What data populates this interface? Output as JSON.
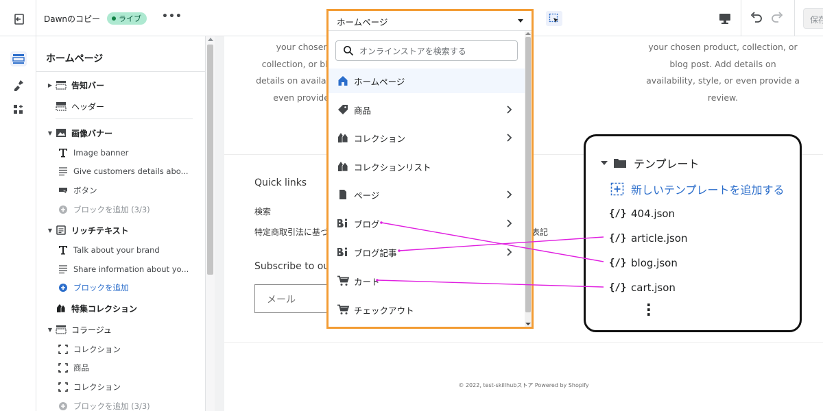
{
  "topbar": {
    "theme_name": "Dawnのコピー",
    "live_badge": "ライブ",
    "more_label": "•••",
    "save_label": "保存"
  },
  "sidebar": {
    "title": "ホームページ",
    "rows": {
      "announcement": "告知バー",
      "header": "ヘッダー",
      "image_banner": "画像バナー",
      "ib_heading": "Image banner",
      "ib_text": "Give customers details abo...",
      "ib_button": "ボタン",
      "ib_add": "ブロックを追加 (3/3)",
      "rich_text": "リッチテキスト",
      "rt_heading": "Talk about your brand",
      "rt_text": "Share information about yo...",
      "rt_add": "ブロックを追加",
      "featured_collection": "特集コレクション",
      "collage": "コラージュ",
      "cl_collection_1": "コレクション",
      "cl_product": "商品",
      "cl_collection_2": "コレクション",
      "cl_add": "ブロックを追加 (3/3)"
    }
  },
  "preview": {
    "feature_text_1": "your chosen product, collection, or blog post. Add details on availability, style, or even provide a review.",
    "feature_text_2": "your chosen product, collection, or blog post. Add details on availability, style, or even provide a review.",
    "quick_links": "Quick links",
    "link_search": "検索",
    "link_legal": "特定商取引法に基づ",
    "link_legal_tail": "表記",
    "subscribe": "Subscribe to ou",
    "email_placeholder": "メール",
    "copyright": "© 2022, test-skillhubストア Powered by Shopify"
  },
  "dropdown": {
    "selected": "ホームページ",
    "search_placeholder": "オンラインストアを検索する",
    "items": [
      {
        "label": "ホームページ",
        "icon": "home-icon",
        "submenu": false
      },
      {
        "label": "商品",
        "icon": "tag-icon",
        "submenu": true
      },
      {
        "label": "コレクション",
        "icon": "collection-icon",
        "submenu": true
      },
      {
        "label": "コレクションリスト",
        "icon": "collection-icon",
        "submenu": false
      },
      {
        "label": "ページ",
        "icon": "page-icon",
        "submenu": true
      },
      {
        "label": "ブログ",
        "icon": "blog-icon",
        "submenu": true
      },
      {
        "label": "ブログ記事",
        "icon": "blog-icon",
        "submenu": true
      },
      {
        "label": "カート",
        "icon": "cart-icon",
        "submenu": false
      },
      {
        "label": "チェックアウト",
        "icon": "cart-icon",
        "submenu": false
      }
    ]
  },
  "callout": {
    "folder": "テンプレート",
    "add_template": "新しいテンプレートを追加する",
    "files": [
      "404.json",
      "article.json",
      "blog.json",
      "cart.json"
    ],
    "file_icon": "{/}"
  },
  "colors": {
    "accent_blue": "#2c6ecb",
    "dropdown_border": "#f39c34",
    "connector": "#e020e0",
    "live_badge": "#aee9d1"
  }
}
